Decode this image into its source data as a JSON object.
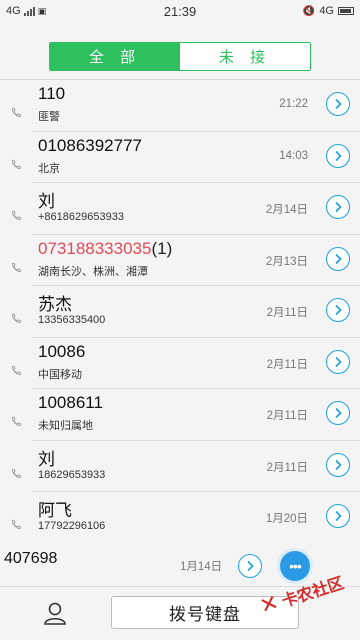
{
  "status_bar": {
    "left_network": "4G",
    "time": "21:39",
    "right_network": "4G"
  },
  "tabs": [
    {
      "label": "全 部",
      "active": true
    },
    {
      "label": "未 接",
      "active": false
    }
  ],
  "calls": [
    {
      "name": "110",
      "subtitle": "匪警",
      "time": "21:22",
      "missed": false,
      "count": ""
    },
    {
      "name": "01086392777",
      "subtitle": "北京",
      "time": "14:03",
      "missed": false,
      "count": ""
    },
    {
      "name": "刘",
      "subtitle": "+8618629653933",
      "time": "2月14日",
      "missed": false,
      "count": ""
    },
    {
      "name": "073188333035",
      "subtitle": "湖南长沙、株洲、湘潭",
      "time": "2月13日",
      "missed": true,
      "count": "(1)"
    },
    {
      "name": "苏杰",
      "subtitle": "13356335400",
      "time": "2月11日",
      "missed": false,
      "count": ""
    },
    {
      "name": "10086",
      "subtitle": "中国移动",
      "time": "2月11日",
      "missed": false,
      "count": ""
    },
    {
      "name": "1008611",
      "subtitle": "未知归属地",
      "time": "2月11日",
      "missed": false,
      "count": ""
    },
    {
      "name": "刘",
      "subtitle": "18629653933",
      "time": "2月11日",
      "missed": false,
      "count": ""
    },
    {
      "name": "阿飞",
      "subtitle": "17792296106",
      "time": "1月20日",
      "missed": false,
      "count": ""
    }
  ],
  "partial_call": {
    "name": "407698",
    "time": "1月14日"
  },
  "bottom": {
    "dial_label": "拨号键盘"
  },
  "bubble": {
    "text": "•••"
  },
  "watermark": {
    "text": "卡农社区"
  },
  "colors": {
    "accent_green": "#2ec05e",
    "missed_red": "#e34a5b",
    "detail_blue": "#1aa0e0"
  }
}
